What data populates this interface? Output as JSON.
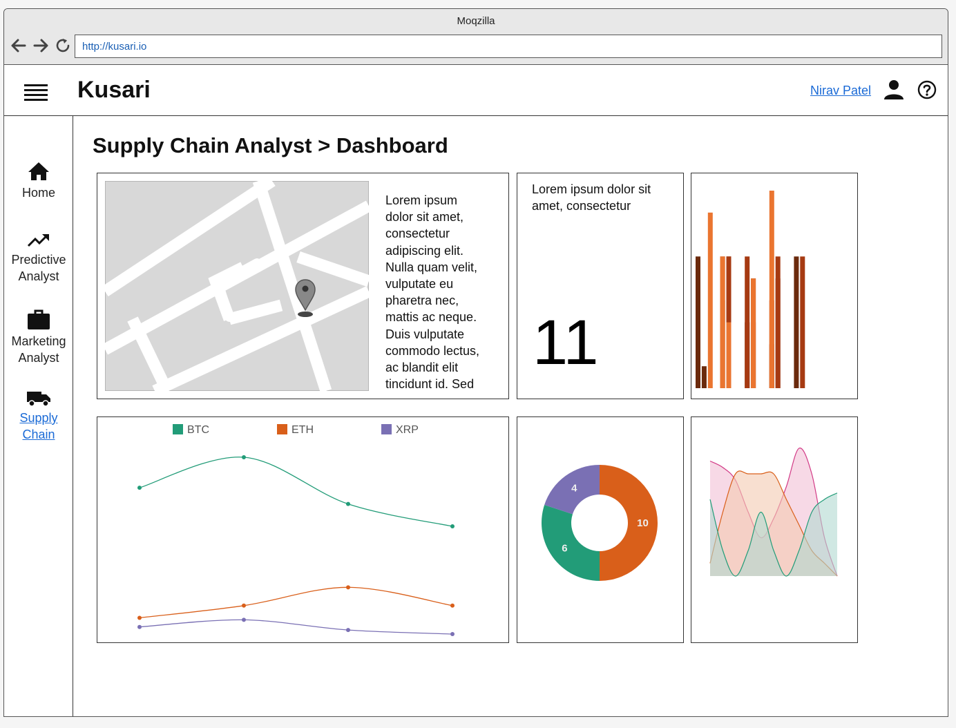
{
  "browser": {
    "title": "Moqzilla",
    "url": "http://kusari.io"
  },
  "app": {
    "brand": "Kusari",
    "user_name": "Nirav Patel",
    "page_title": "Supply Chain Analyst > Dashboard"
  },
  "sidebar": {
    "items": [
      {
        "label_1": "Home",
        "label_2": "",
        "icon": "home-icon",
        "active": false
      },
      {
        "label_1": "Predictive",
        "label_2": "Analyst",
        "icon": "trending-up-icon",
        "active": false
      },
      {
        "label_1": "Marketing",
        "label_2": "Analyst",
        "icon": "briefcase-icon",
        "active": false
      },
      {
        "label_1": "Supply",
        "label_2": "Chain",
        "icon": "truck-icon",
        "active": true
      }
    ]
  },
  "cards": {
    "map_text": [
      "Lorem ipsum",
      "dolor sit amet,",
      "consectetur",
      "adipiscing elit.",
      "Nulla quam velit,",
      "vulputate eu",
      "pharetra nec,",
      "mattis ac neque.",
      "Duis vulputate",
      "commodo lectus,",
      "ac blandit elit",
      "tincidunt id. Sed"
    ],
    "stat": {
      "line_1": "Lorem ipsum dolor sit",
      "line_2": "amet, consectetur",
      "value": "11"
    }
  },
  "colors": {
    "btc": "#229c78",
    "eth": "#d95f1a",
    "xrp": "#7a70b4",
    "bar_dark": "#6b2a0c",
    "bar_mid": "#a63a12",
    "bar_light": "#ea7530"
  },
  "chart_data": [
    {
      "type": "bar",
      "series": [
        {
          "values": [
            6,
            1,
            0,
            0,
            4,
            6,
            0,
            0,
            3,
            5,
            0,
            0,
            2,
            5,
            0,
            0,
            6,
            0,
            0,
            0
          ]
        },
        {
          "values": [
            0,
            0,
            0,
            0,
            6,
            6,
            0,
            0,
            6,
            3,
            0,
            0,
            4,
            6,
            0,
            0,
            0,
            6,
            0,
            0
          ]
        },
        {
          "values": [
            0,
            0,
            8,
            0,
            6,
            3,
            0,
            0,
            0,
            5,
            0,
            0,
            9,
            0,
            0,
            0,
            0,
            0,
            0,
            0
          ]
        }
      ]
    },
    {
      "type": "line",
      "x": [
        1,
        2,
        3,
        4
      ],
      "series": [
        {
          "name": "BTC",
          "values": [
            70,
            85,
            62,
            51
          ]
        },
        {
          "name": "ETH",
          "values": [
            6,
            12,
            21,
            12
          ]
        },
        {
          "name": "XRP",
          "values": [
            1.5,
            5,
            0,
            -2
          ]
        }
      ]
    },
    {
      "type": "pie",
      "labels": [
        "ETH",
        "BTC",
        "XRP"
      ],
      "values": [
        10,
        6,
        4
      ]
    },
    {
      "type": "area",
      "x": [
        0,
        1,
        2,
        3,
        4,
        5,
        6,
        7,
        8,
        9,
        10
      ],
      "series": [
        {
          "values": [
            9,
            8.5,
            7.5,
            5,
            3,
            4.5,
            7,
            10,
            8,
            3,
            0
          ]
        },
        {
          "values": [
            1,
            5,
            8,
            8,
            8,
            8,
            6,
            4,
            2,
            1,
            0
          ]
        },
        {
          "values": [
            6,
            2,
            0,
            2,
            5,
            2,
            0,
            2,
            5,
            6,
            6.5
          ]
        }
      ]
    }
  ]
}
